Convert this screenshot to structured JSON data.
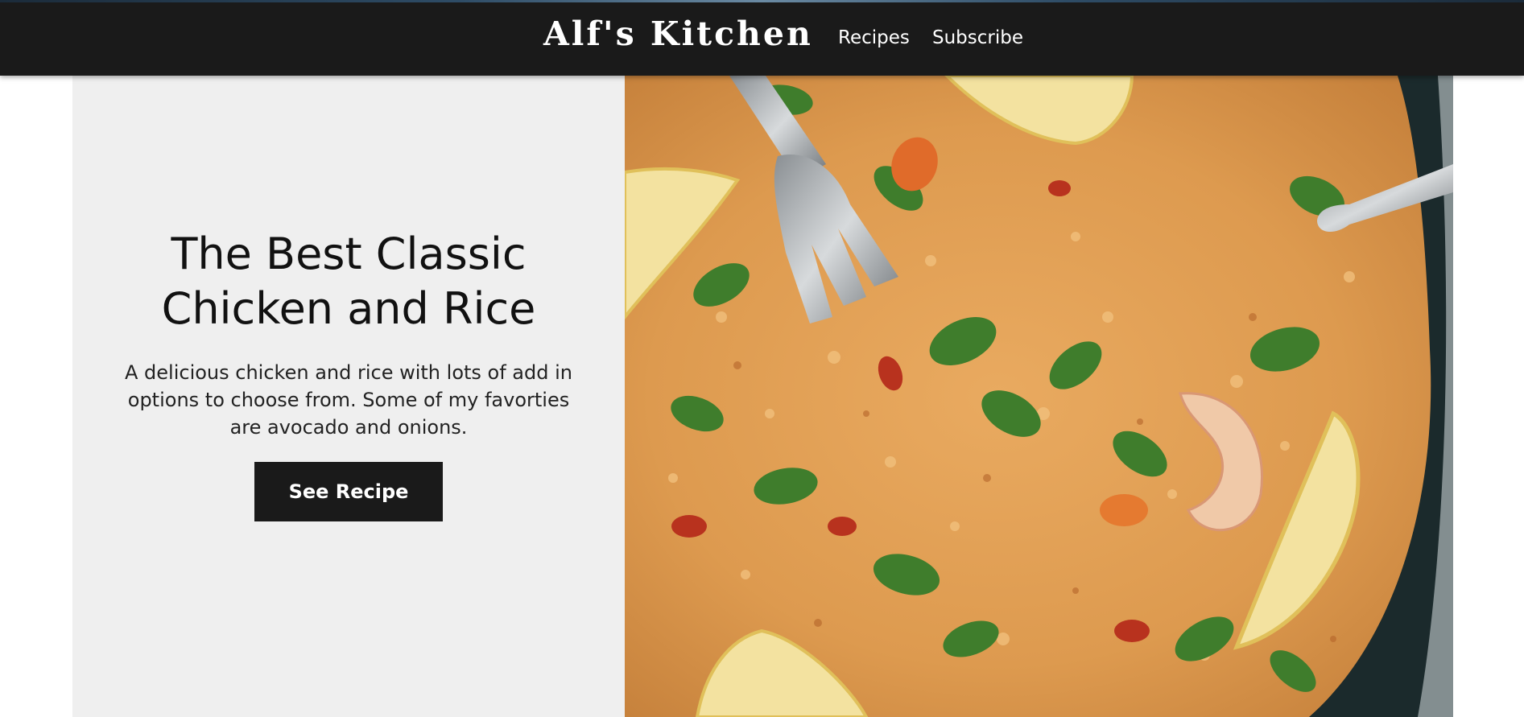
{
  "header": {
    "brand": "Alf's Kitchen",
    "nav": [
      {
        "label": "Recipes"
      },
      {
        "label": "Subscribe"
      }
    ]
  },
  "hero": {
    "title_line1": "The Best Classic",
    "title_line2": "Chicken and Rice",
    "description": "A delicious chicken and rice with lots of add in options to choose from. Some of my favorties are avocado and onions.",
    "button_label": "See Recipe",
    "image_subject": "chicken-and-rice-dish-photo",
    "colors": {
      "header_bg": "#1a1a1a",
      "panel_bg": "#efefef",
      "button_bg": "#1a1a1a",
      "rice": "#e3a257",
      "herbs": "#3f7d2c",
      "lemon": "#f3e2a0",
      "bowl": "#1b2a2c"
    }
  }
}
